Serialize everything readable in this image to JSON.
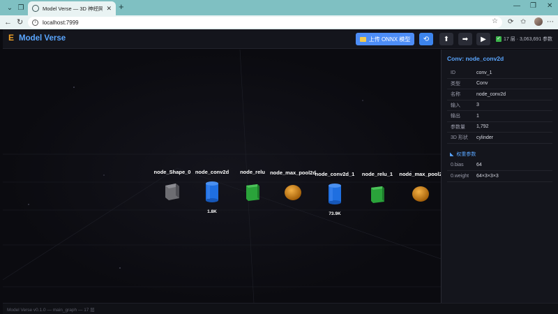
{
  "browser": {
    "tab_title": "Model Verse — 3D 神经网络可视化",
    "url": "localhost:7999"
  },
  "app": {
    "title": "Model Verse",
    "upload_label": "上传 ONNX 模型",
    "stats": "17 层 · 3,063,691 参数"
  },
  "graph": {
    "nodes": [
      {
        "name": "node_Shape_0",
        "shape": "cube-gray",
        "params": ""
      },
      {
        "name": "node_conv2d",
        "shape": "cylinder",
        "params": "1.8K"
      },
      {
        "name": "node_relu",
        "shape": "cube-green",
        "params": ""
      },
      {
        "name": "node_max_pool2d",
        "shape": "sphere",
        "params": ""
      },
      {
        "name": "node_conv2d_1",
        "shape": "cylinder",
        "params": "73.9K"
      },
      {
        "name": "node_relu_1",
        "shape": "cube-green",
        "params": ""
      },
      {
        "name": "node_max_pool2",
        "shape": "sphere",
        "params": ""
      }
    ]
  },
  "sidebar": {
    "title": "Conv: node_conv2d",
    "props": [
      {
        "key": "ID",
        "value": "conv_1"
      },
      {
        "key": "类型",
        "value": "Conv"
      },
      {
        "key": "名称",
        "value": "node_conv2d"
      },
      {
        "key": "输入",
        "value": "3"
      },
      {
        "key": "输出",
        "value": "1"
      },
      {
        "key": "参数量",
        "value": "1,792"
      },
      {
        "key": "3D 形状",
        "value": "cylinder"
      }
    ],
    "weights_title": "权重参数",
    "weights": [
      {
        "key": "0.bias",
        "value": "64"
      },
      {
        "key": "0.weight",
        "value": "64×3×3×3"
      }
    ]
  },
  "footer": "Model Verse v0.1.0 — main_graph — 17 层",
  "colors": {
    "accent": "#5aa6ff",
    "upload": "#4d8df6",
    "cylinder": "#1f6fe0",
    "cube_green": "#2aa33a",
    "sphere": "#e08a12",
    "cube_gray": "#6d6d72"
  }
}
